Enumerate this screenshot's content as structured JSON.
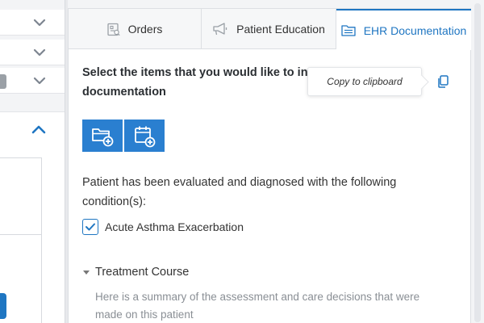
{
  "tabs": [
    {
      "label": "Orders",
      "icon": "orders-icon"
    },
    {
      "label": "Patient Education",
      "icon": "megaphone-icon"
    },
    {
      "label": "EHR Documentation",
      "icon": "folder-list-icon",
      "active": true
    }
  ],
  "content": {
    "heading": "Select the items that you would like to include in documentation",
    "tooltip": "Copy to clipboard",
    "copy_icon": "copy-icon",
    "tool_buttons": [
      {
        "icon": "add-folder-icon"
      },
      {
        "icon": "add-calendar-icon"
      }
    ],
    "description": "Patient has been evaluated and diagnosed with the following condition(s):",
    "conditions": [
      {
        "label": "Acute Asthma Exacerbation",
        "checked": true
      }
    ],
    "section": {
      "title": "Treatment Course",
      "description": "Here is a summary of the assessment and care decisions that were made on this patient"
    }
  },
  "colors": {
    "accent": "#1f76c2",
    "button": "#2a7fd0",
    "muted_text": "#8a8f95"
  }
}
